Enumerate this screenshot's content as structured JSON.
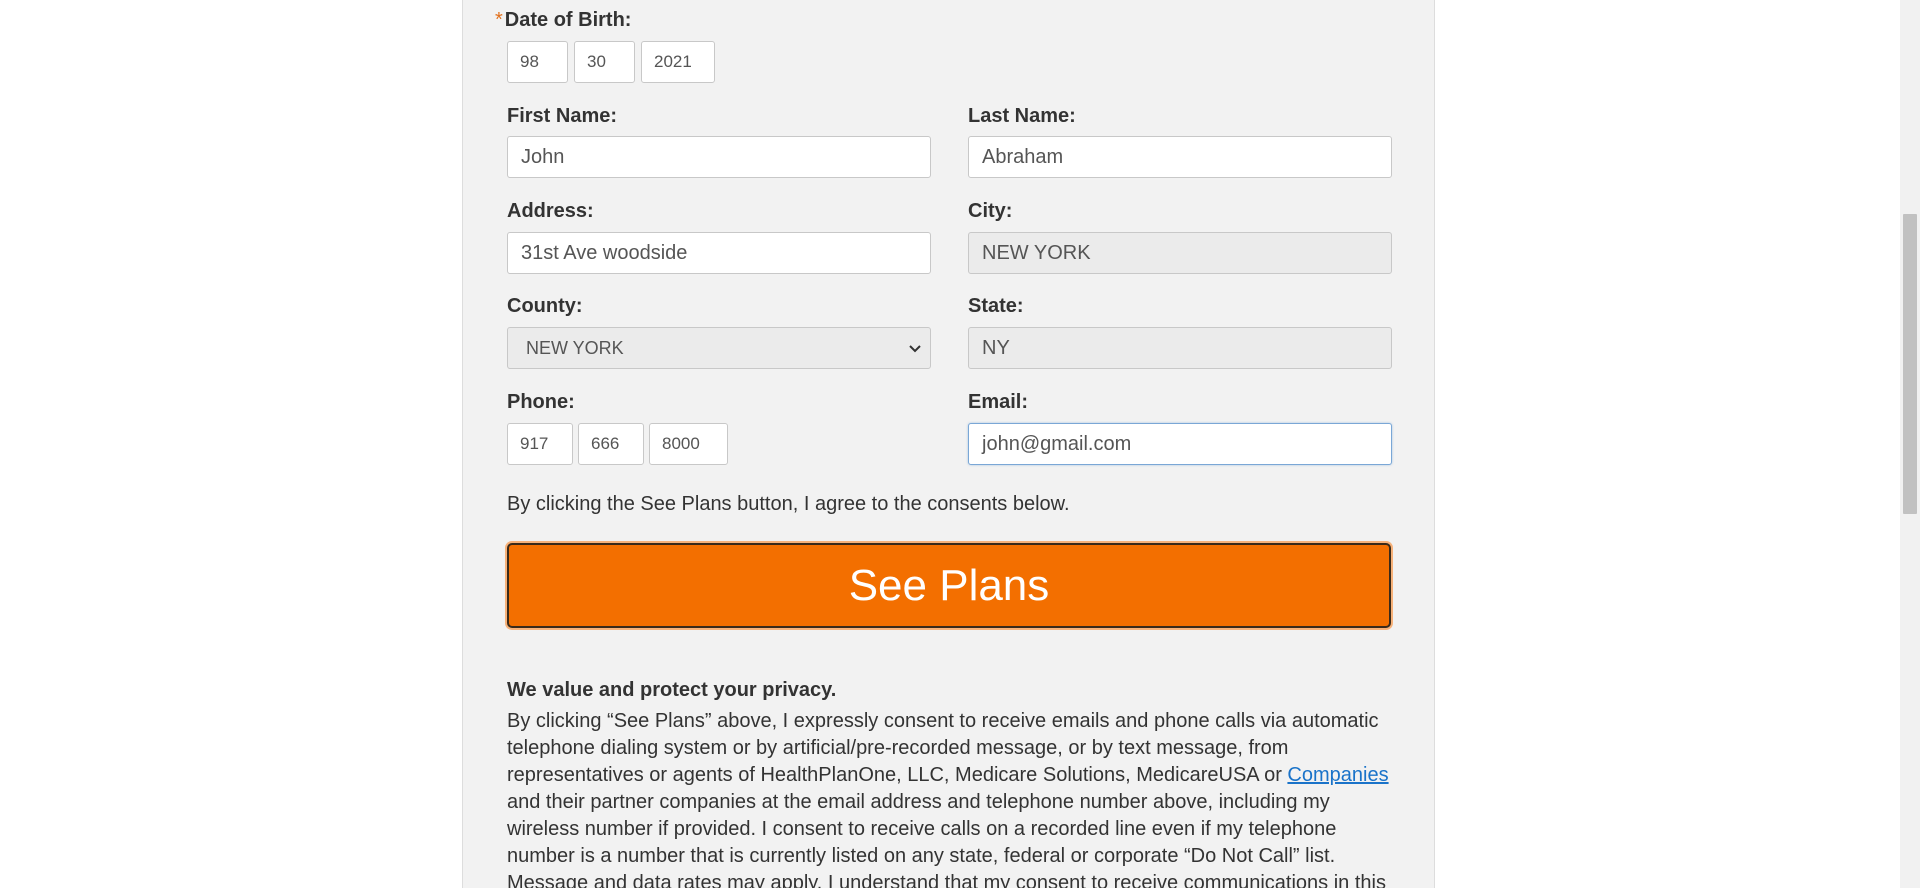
{
  "form": {
    "dob": {
      "required_mark": "*",
      "label": "Date of Birth:",
      "month": "98",
      "day": "30",
      "year": "2021"
    },
    "first_name": {
      "label": "First Name:",
      "value": "John"
    },
    "last_name": {
      "label": "Last Name:",
      "value": "Abraham"
    },
    "address": {
      "label": "Address:",
      "value": "31st Ave woodside"
    },
    "city": {
      "label": "City:",
      "value": "NEW YORK"
    },
    "county": {
      "label": "County:",
      "value": "NEW YORK"
    },
    "state": {
      "label": "State:",
      "value": "NY"
    },
    "phone": {
      "label": "Phone:",
      "area": "917",
      "prefix": "666",
      "line": "8000"
    },
    "email": {
      "label": "Email:",
      "value": "john@gmail.com"
    },
    "consent_notice": "By clicking the See Plans button, I agree to the consents below.",
    "submit_label": "See Plans"
  },
  "privacy": {
    "title": "We value and protect your privacy.",
    "body_part1": "By clicking “See Plans” above, I expressly consent to receive emails and phone calls via automatic telephone dialing system or by artificial/pre-recorded message, or by text message, from representatives or agents of HealthPlanOne, LLC, Medicare Solutions, MedicareUSA or ",
    "companies_link": "Companies",
    "body_part2": " and their partner companies at the email address and telephone number above, including my wireless number if provided. I consent to receive calls on a recorded line even if my telephone number is a number that is currently listed on any state, federal or corporate “Do Not Call” list. Message and data rates may apply. I understand that my consent to receive communications in this"
  },
  "colors": {
    "button": "#f36f00",
    "link": "#1a73c9",
    "panel": "#f2f2f2"
  },
  "icons": {
    "select_arrow": "chevron-down-icon"
  }
}
